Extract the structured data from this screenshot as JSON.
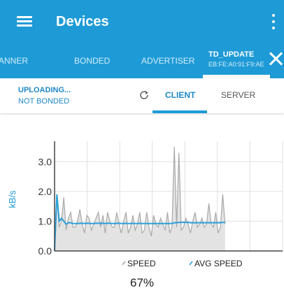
{
  "app": {
    "title": "Devices",
    "color_primary": "#1e9bd7"
  },
  "tabs": [
    {
      "label": "ANNER"
    },
    {
      "label": "BONDED"
    },
    {
      "label": "ADVERTISER"
    }
  ],
  "active_tab": {
    "label": "TD_UPDATE",
    "address": "EB:FE:A0:91:F9:AE"
  },
  "status": {
    "line1": "UPLOADING...",
    "line2": "NOT BONDED"
  },
  "subtabs": {
    "client": "CLIENT",
    "server": "SERVER",
    "active": "CLIENT"
  },
  "progress": {
    "text": "67%",
    "value": 0.67
  },
  "chart_data": {
    "type": "line",
    "ylabel": "kB/s",
    "xlabel": "",
    "yticks": [
      "0.0",
      "1.0",
      "2.0",
      "3.0"
    ],
    "ylim": [
      0,
      3.5
    ],
    "grid": true,
    "x_samples_total": 100,
    "legend_position": "bottom",
    "legend": [
      "SPEED",
      "AVG SPEED"
    ],
    "series": [
      {
        "name": "SPEED",
        "color": "#a9a9a9",
        "fill": "#e3e3e3",
        "values": [
          0.0,
          1.9,
          0.8,
          1.0,
          1.8,
          0.7,
          1.1,
          1.3,
          0.8,
          0.8,
          1.0,
          1.4,
          0.9,
          0.6,
          1.2,
          1.1,
          0.7,
          0.9,
          1.1,
          1.3,
          0.8,
          1.2,
          0.6,
          1.3,
          1.0,
          0.8,
          0.8,
          1.3,
          0.9,
          0.6,
          1.0,
          1.3,
          0.6,
          0.8,
          1.2,
          0.7,
          0.9,
          1.3,
          0.6,
          0.7,
          1.3,
          0.8,
          0.5,
          1.2,
          0.9,
          0.8,
          1.1,
          0.9,
          0.7,
          1.3,
          0.6,
          0.8,
          4.0,
          0.8,
          3.3,
          0.7,
          0.8,
          1.1,
          0.9,
          0.6,
          1.0,
          1.3,
          0.8,
          0.9,
          1.1,
          0.8,
          0.9,
          1.6,
          0.9,
          0.8,
          1.3,
          0.6,
          0.8,
          1.9,
          0.9
        ]
      },
      {
        "name": "AVG SPEED",
        "color": "#2a9fd8",
        "values": [
          0.0,
          1.9,
          1.0,
          1.1,
          1.0,
          0.9,
          0.95,
          0.95,
          0.92,
          0.92,
          0.92,
          0.93,
          0.93,
          0.92,
          0.93,
          0.93,
          0.92,
          0.92,
          0.93,
          0.93,
          0.93,
          0.93,
          0.92,
          0.93,
          0.93,
          0.92,
          0.92,
          0.93,
          0.93,
          0.92,
          0.92,
          0.93,
          0.92,
          0.92,
          0.93,
          0.92,
          0.92,
          0.93,
          0.92,
          0.92,
          0.92,
          0.92,
          0.92,
          0.92,
          0.92,
          0.92,
          0.92,
          0.92,
          0.92,
          0.92,
          0.92,
          0.92,
          0.95,
          0.95,
          0.96,
          0.96,
          0.96,
          0.96,
          0.96,
          0.95,
          0.95,
          0.95,
          0.95,
          0.95,
          0.95,
          0.95,
          0.95,
          0.95,
          0.95,
          0.95,
          0.95,
          0.95,
          0.95,
          0.96,
          0.96
        ]
      }
    ]
  }
}
